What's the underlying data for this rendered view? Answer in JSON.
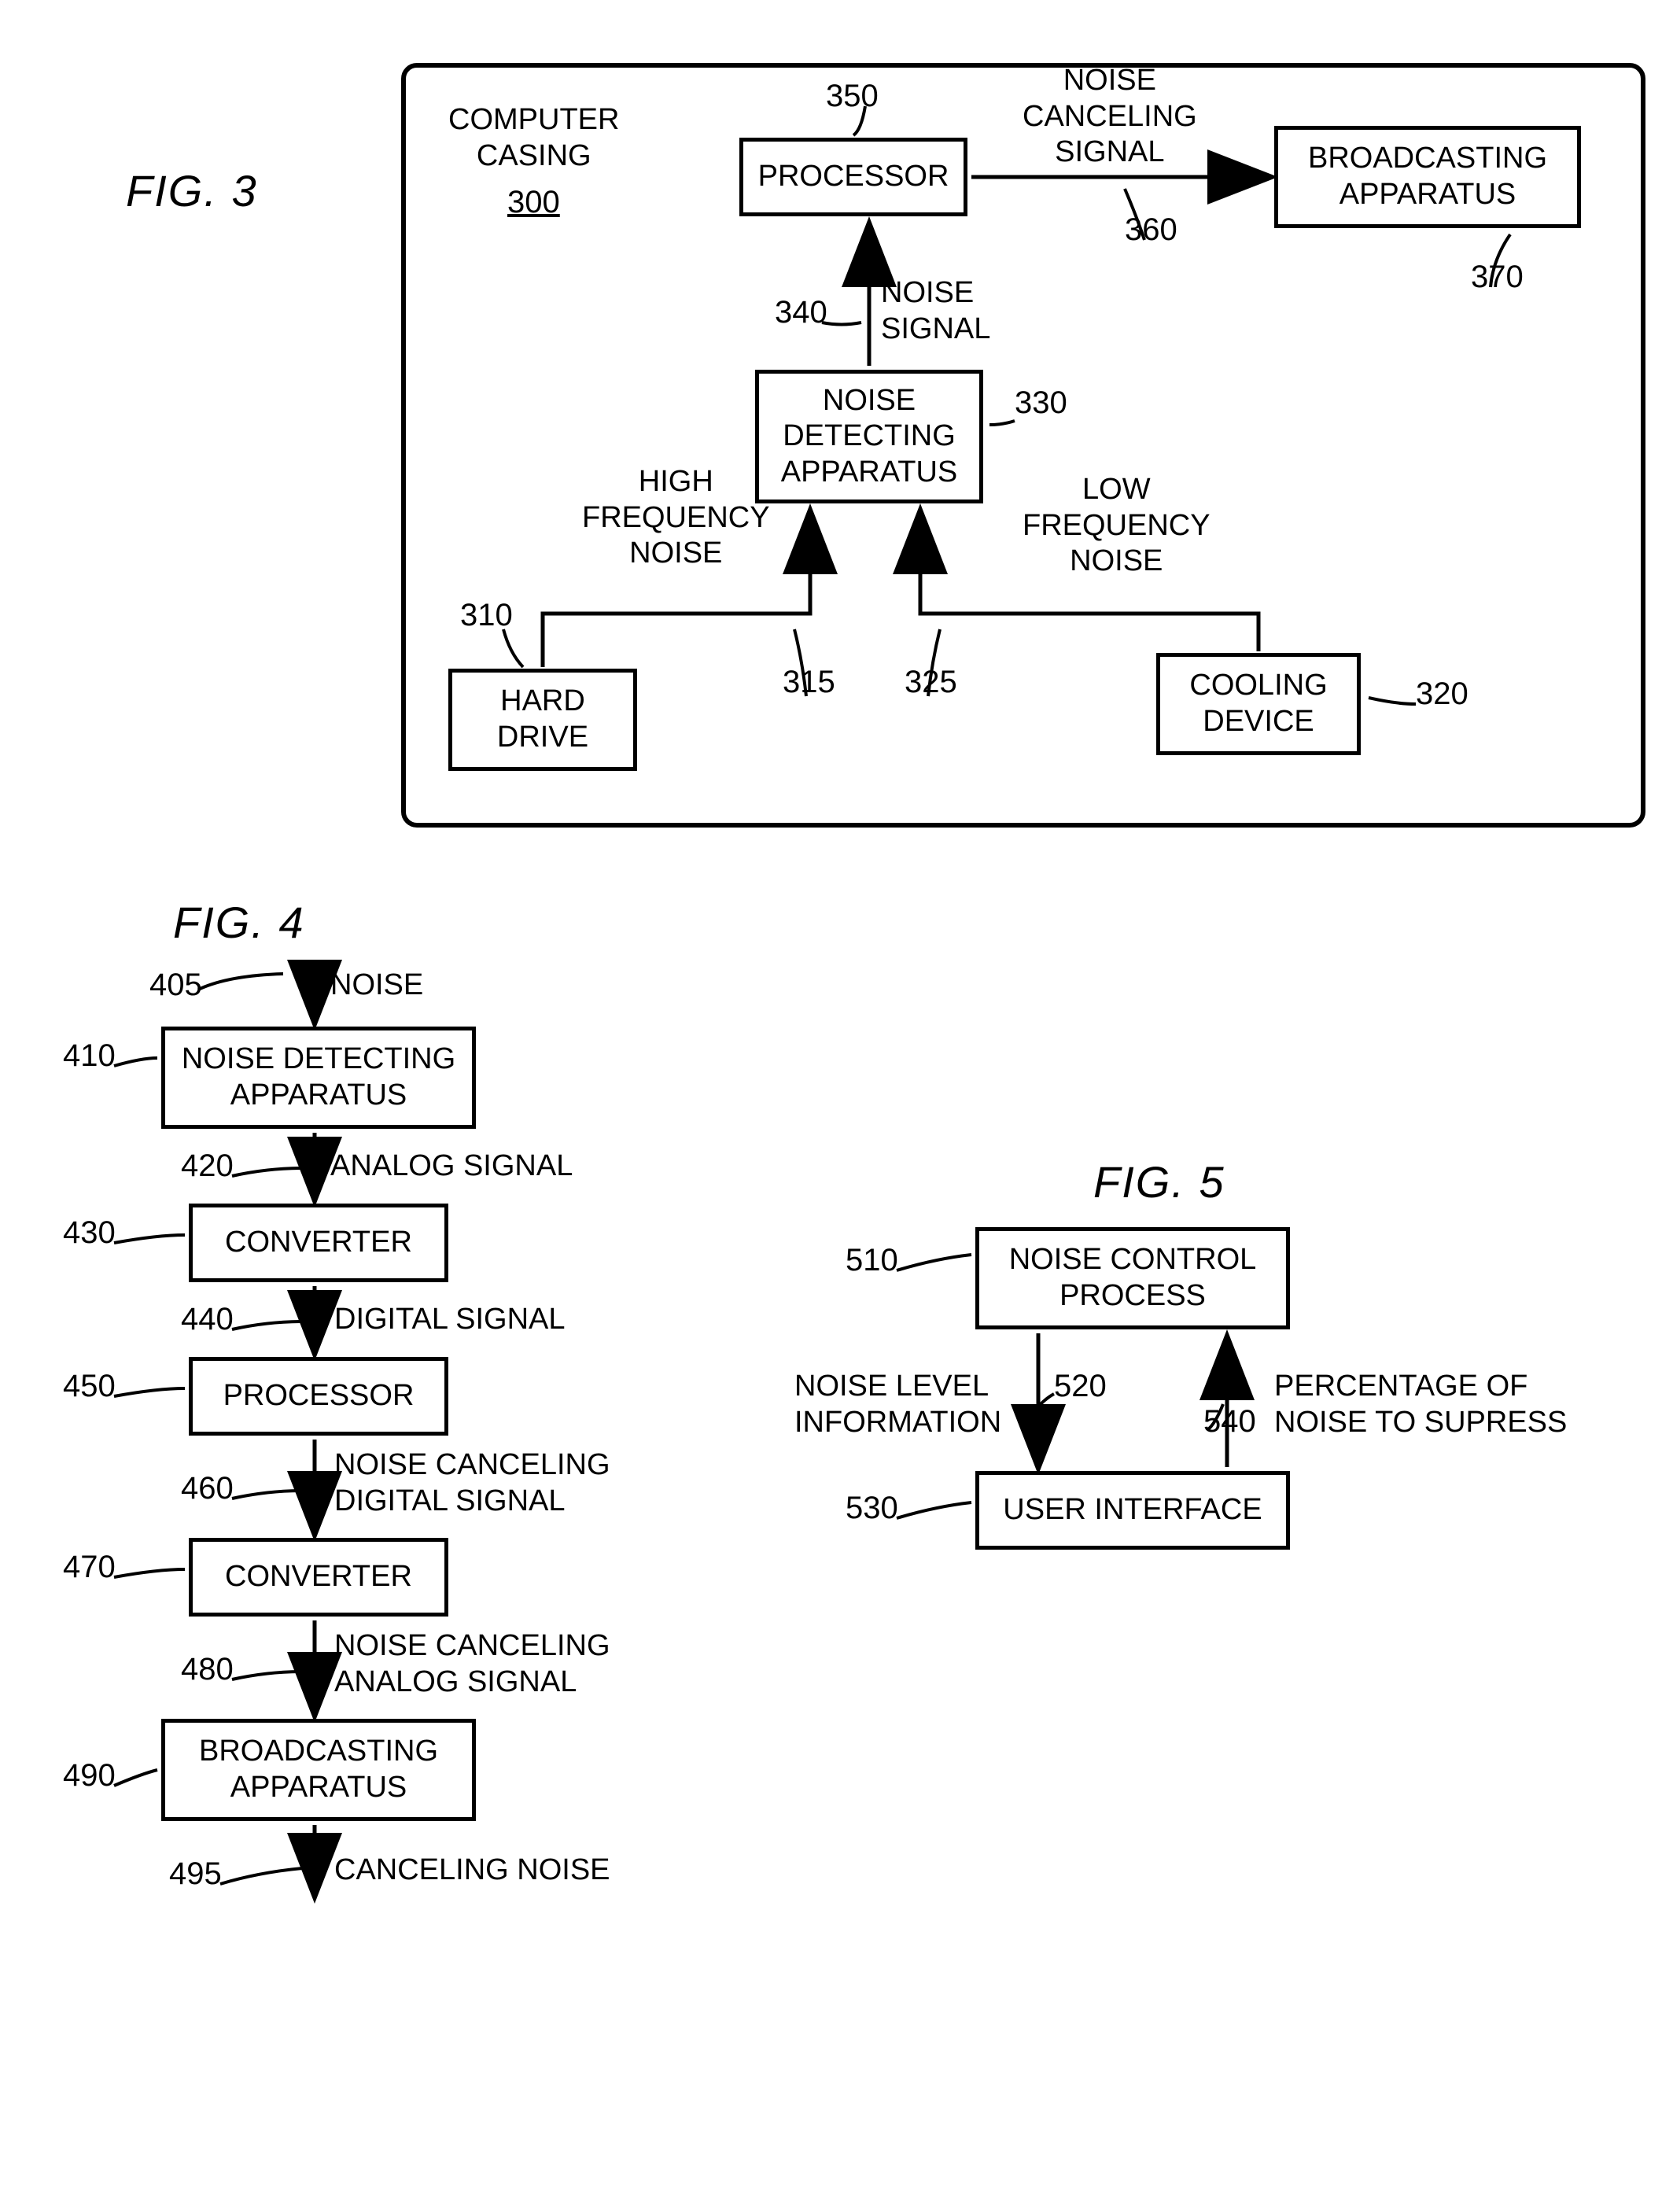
{
  "fig3": {
    "title": "FIG.  3",
    "casing_label": "COMPUTER\nCASING",
    "casing_ref": "300",
    "processor_ref": "350",
    "processor_label": "PROCESSOR",
    "cancel_signal_label": "NOISE\nCANCELING\nSIGNAL",
    "cancel_signal_ref": "360",
    "broadcast_label": "BROADCASTING\nAPPARATUS",
    "broadcast_ref": "370",
    "noise_signal_ref": "340",
    "noise_signal_label": "NOISE\nSIGNAL",
    "detect_label": "NOISE\nDETECTING\nAPPARATUS",
    "detect_ref": "330",
    "hf_label": "HIGH\nFREQUENCY\nNOISE",
    "lf_label": "LOW\nFREQUENCY\nNOISE",
    "hd_ref": "310",
    "hd_label": "HARD\nDRIVE",
    "hf_ref": "315",
    "lf_ref": "325",
    "cool_label": "COOLING\nDEVICE",
    "cool_ref": "320"
  },
  "fig4": {
    "title": "FIG.  4",
    "s405_ref": "405",
    "s405_label": "NOISE",
    "b410_ref": "410",
    "b410_label": "NOISE DETECTING\nAPPARATUS",
    "s420_ref": "420",
    "s420_label": "ANALOG SIGNAL",
    "b430_ref": "430",
    "b430_label": "CONVERTER",
    "s440_ref": "440",
    "s440_label": "DIGITAL SIGNAL",
    "b450_ref": "450",
    "b450_label": "PROCESSOR",
    "s460_ref": "460",
    "s460_label": "NOISE CANCELING\nDIGITAL SIGNAL",
    "b470_ref": "470",
    "b470_label": "CONVERTER",
    "s480_ref": "480",
    "s480_label": "NOISE CANCELING\nANALOG SIGNAL",
    "b490_ref": "490",
    "b490_label": "BROADCASTING\nAPPARATUS",
    "s495_ref": "495",
    "s495_label": "CANCELING NOISE"
  },
  "fig5": {
    "title": "FIG.  5",
    "b510_ref": "510",
    "b510_label": "NOISE CONTROL\nPROCESS",
    "left_label": "NOISE LEVEL\nINFORMATION",
    "left_ref": "520",
    "right_ref": "540",
    "right_label": "PERCENTAGE OF\nNOISE TO SUPRESS",
    "b530_ref": "530",
    "b530_label": "USER INTERFACE"
  }
}
